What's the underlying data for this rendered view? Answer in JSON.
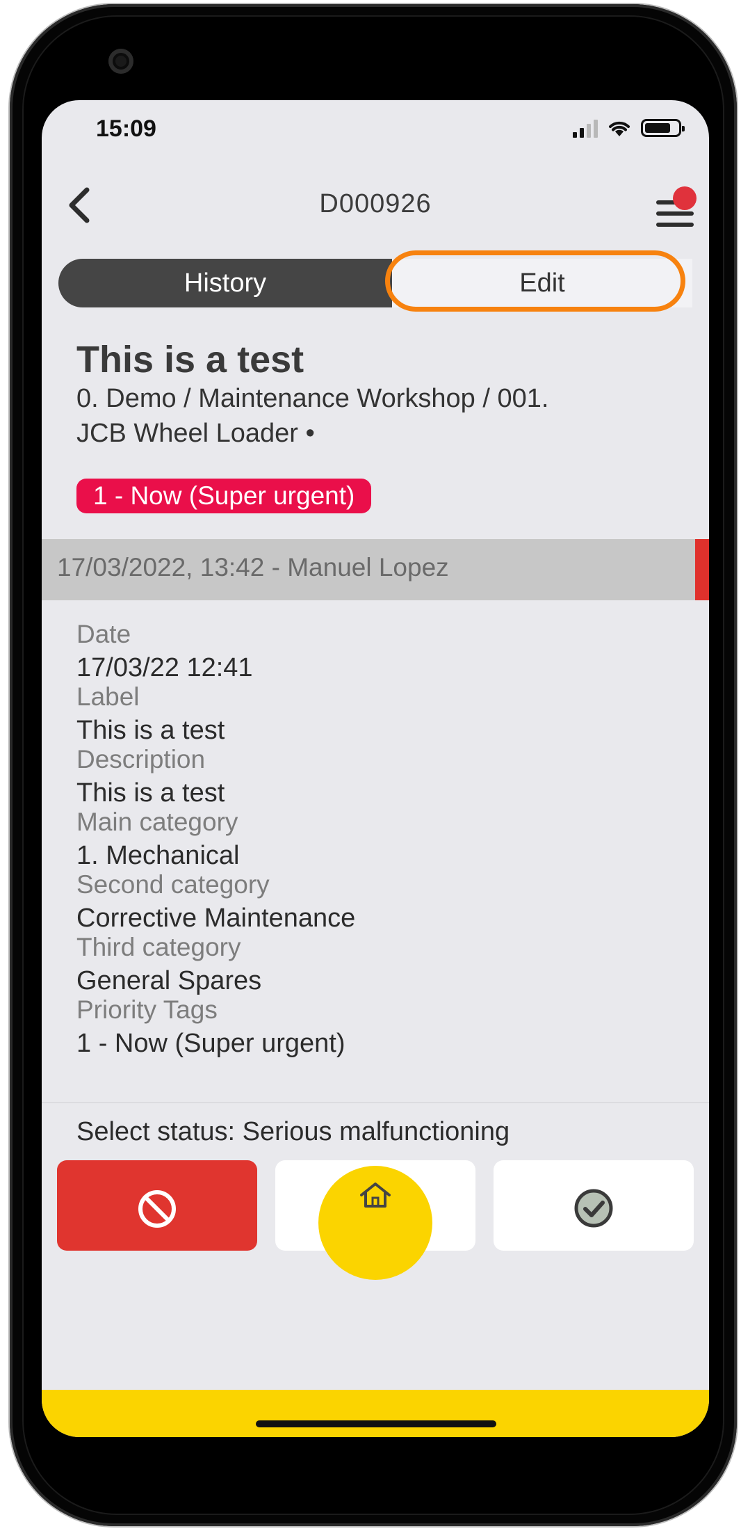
{
  "status_bar": {
    "time": "15:09"
  },
  "nav": {
    "title": "D000926"
  },
  "tabs": [
    {
      "label": "History"
    },
    {
      "label": "Edit"
    }
  ],
  "record": {
    "title": "This is a test",
    "path_line1": "0. Demo / Maintenance Workshop / 001.",
    "path_line2": "JCB Wheel Loader •",
    "priority_badge": "1 - Now (Super urgent)",
    "priority_color": "#ea0f4a"
  },
  "entry": {
    "header": "17/03/2022, 13:42 - Manuel Lopez"
  },
  "fields": [
    {
      "label": "Date",
      "value": "17/03/22 12:41"
    },
    {
      "label": "Label",
      "value": "This is a test"
    },
    {
      "label": "Description",
      "value": "This is a test"
    },
    {
      "label": "Main category",
      "value": "1. Mechanical"
    },
    {
      "label": "Second category",
      "value": "Corrective Maintenance"
    },
    {
      "label": "Third category",
      "value": "General Spares"
    },
    {
      "label": "Priority Tags",
      "value": "1 - Now (Super urgent)"
    }
  ],
  "status": {
    "select_text": "Select status: Serious malfunctioning"
  },
  "actions": [
    {
      "icon": "prohibited-icon",
      "color": "#e0352f"
    },
    {
      "icon": "home-icon",
      "color": "#fbd400"
    },
    {
      "icon": "check-circle-icon",
      "color": "#ffffff"
    }
  ],
  "colors": {
    "accent_highlight": "#f7820f",
    "bottom_bar": "#fbd400",
    "entry_accent": "#e0312c"
  }
}
